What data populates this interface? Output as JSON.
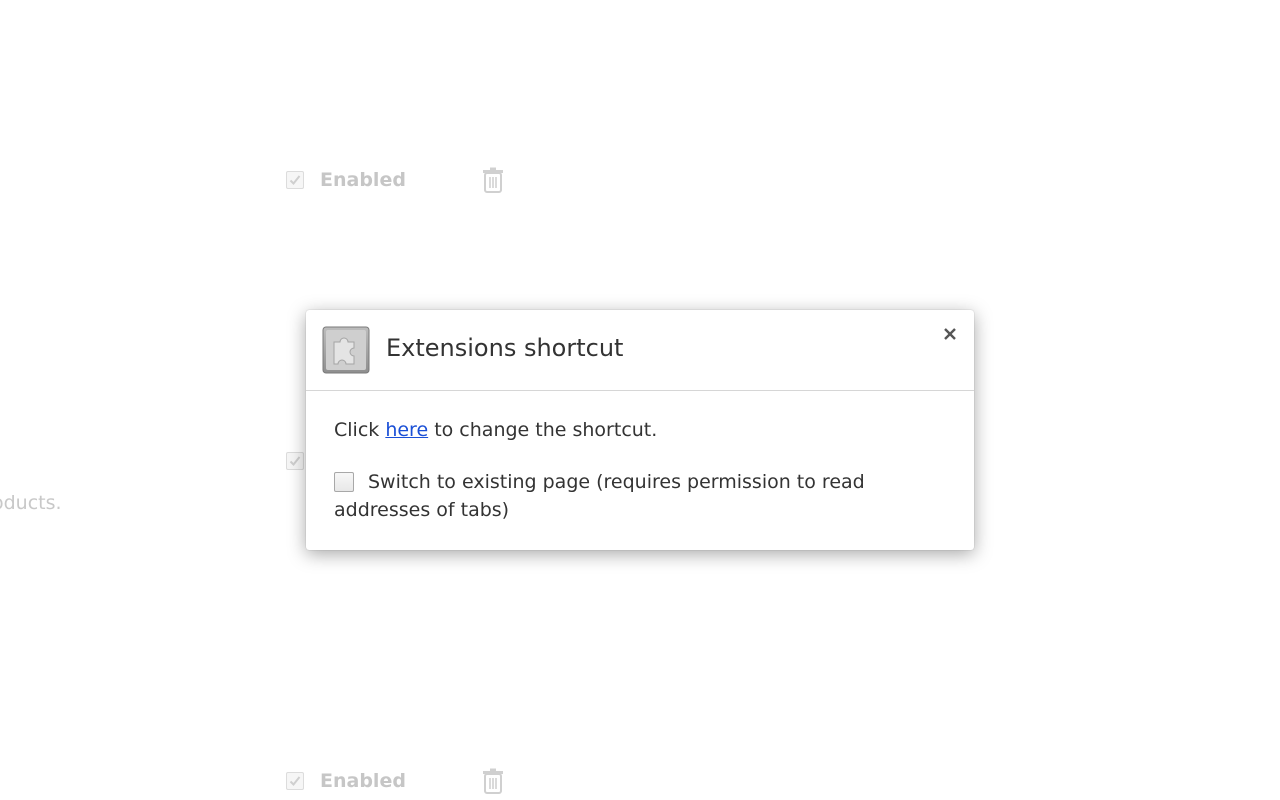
{
  "background": {
    "rows": [
      {
        "label": "Enabled"
      },
      {
        "label": "Enabled"
      }
    ],
    "partial_description": "oducts."
  },
  "dialog": {
    "title": "Extensions shortcut",
    "icon": "puzzle-piece-icon",
    "close_icon": "close-icon",
    "body": {
      "prefix": "Click ",
      "link_text": "here",
      "suffix": " to change the shortcut."
    },
    "option": {
      "label_line1": "Switch to existing page (requires permission to read",
      "label_line2": "addresses of tabs)",
      "checked": false
    }
  },
  "colors": {
    "link": "#1a4fd6",
    "text": "#333333",
    "dimmed": "#c6c6c6"
  }
}
